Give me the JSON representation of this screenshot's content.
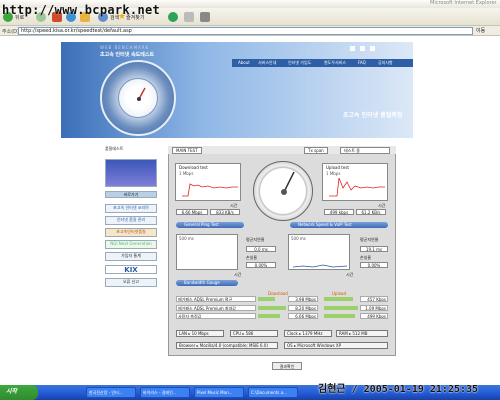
{
  "window": {
    "title": "Microsoft Internet Explorer"
  },
  "watermark": "http://www.bcpark.net",
  "toolbar": {
    "back": "뒤로",
    "search": "검색",
    "favorites": "즐겨찾기"
  },
  "address": {
    "label": "주소(D)",
    "url": "http://speed.kisa.or.kr/speedtest/default.asp",
    "go": "이동"
  },
  "banner": {
    "brand_en": "WEB BENCHMARK",
    "brand_kr": "초고속 인터넷 속도테스트",
    "title": "초고속 인터넷 품질측정",
    "nav": [
      "About",
      "서비스안내",
      "인터넷 가입도",
      "윈도우서비스",
      "FAQ",
      "공지사항"
    ]
  },
  "sidebar": {
    "heading": "품질테스트",
    "items": [
      "바로가기",
      "초고속 인터넷 코리아",
      "인터넷 품질 관리",
      "초고속인터넷품질",
      "NGI Next Generation",
      "가입자 통계",
      "KIX",
      "오류 신고"
    ]
  },
  "tabs": {
    "main": "MAIN TEST",
    "version": "Tx span",
    "mode": "테스트 중"
  },
  "download": {
    "label": "Download test",
    "scale": "1 Mbps",
    "time_label": "시간",
    "mbps": "6.66 Mbps",
    "kbs": "833 KB/s"
  },
  "upload": {
    "label": "Upload test",
    "scale": "1 Mbps",
    "time_label": "시간",
    "kbs": "499 kbps",
    "kbs2": "61.2 KB/s"
  },
  "tools": {
    "general": "General Ping Test",
    "network": "Network Speed & VoIP Test"
  },
  "ping_left": {
    "avg_label": "평균지연율",
    "avg": "0.0 ms",
    "loss_label": "손실율",
    "loss": "0.00%",
    "jitter_label": "",
    "time_label": "시간",
    "scale": "500 ms"
  },
  "ping_right": {
    "avg_label": "평균지연율",
    "avg": "19.1 ms",
    "loss_label": "손실율",
    "loss": "0.00%",
    "time_label": "시간",
    "scale": "500 ms"
  },
  "bandwidth": {
    "label": "Bandwidth Gauge"
  },
  "results_header": {
    "download": "Download",
    "upload": "Upload"
  },
  "results": [
    {
      "name": "메가패스 ADSL Premium 평균",
      "down": "3.98 Mbps",
      "up": "457 Kbps",
      "down_frac": 0.6,
      "up_frac": 0.85
    },
    {
      "name": "메가패스 ADSL Premium 최대값",
      "down": "8.20 Mbps",
      "up": "1.09 Mbps",
      "down_frac": 1.0,
      "up_frac": 1.0
    },
    {
      "name": "사용자 측정값",
      "down": "6.66 Mbps",
      "up": "499 Kbps",
      "down_frac": 0.8,
      "up_frac": 0.9
    }
  ],
  "sysinfo": {
    "lan": "LAN ▸ 10 Mbps",
    "cpu": "CPU ▸ 586",
    "clock": "Clock ▸ 1379 MHz",
    "ram": "RAM ▸ 512 MB",
    "browser": "Browser ▸ Mozilla/4.0 (compatible; MSIE 6.0)",
    "os": "OS ▸ Microsoft Windows XP"
  },
  "confirm": "결과확인",
  "taskbar": {
    "start": "시작",
    "tasks": [
      "한국전산망 - 인터...",
      "바이러스 - 걸레인...",
      "Pixel Music Man...",
      "C:\\Documents a..."
    ]
  },
  "stamp": "김현근 / 2005-01-19 21:25:35"
}
